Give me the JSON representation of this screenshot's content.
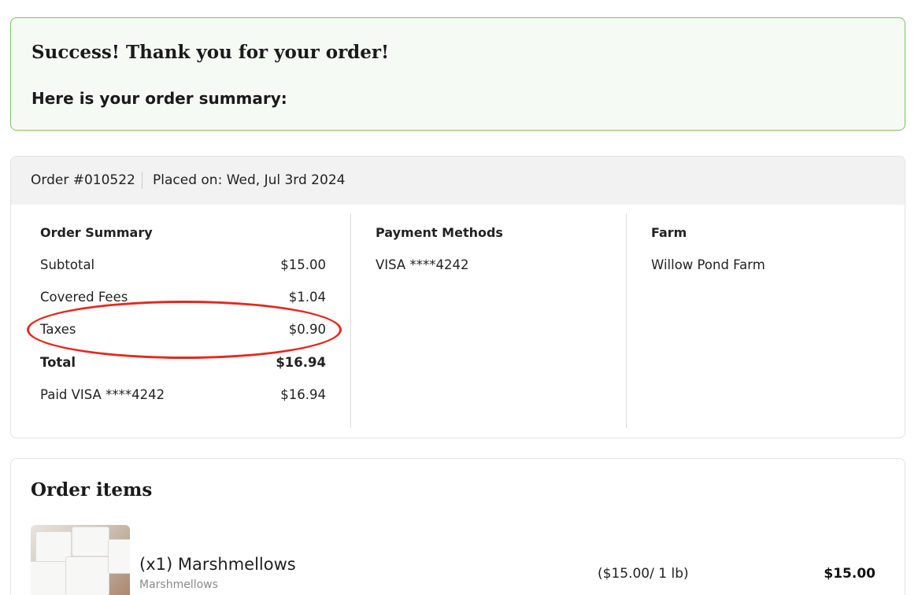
{
  "success": {
    "title": "Success! Thank you for your order!",
    "subtitle": "Here is your order summary:"
  },
  "order": {
    "number": "Order #010522",
    "placed_on": "Placed on: Wed, Jul 3rd 2024"
  },
  "summary": {
    "heading": "Order Summary",
    "rows": [
      {
        "label": "Subtotal",
        "value": "$15.00"
      },
      {
        "label": "Covered Fees",
        "value": "$1.04"
      },
      {
        "label": "Taxes",
        "value": "$0.90"
      },
      {
        "label": "Total",
        "value": "$16.94"
      },
      {
        "label": "Paid VISA ****4242",
        "value": "$16.94"
      }
    ]
  },
  "payment": {
    "heading": "Payment Methods",
    "method": "VISA ****4242"
  },
  "farm": {
    "heading": "Farm",
    "name": "Willow Pond Farm"
  },
  "items": {
    "title": "Order items",
    "list": [
      {
        "name": "(x1) Marshmellows",
        "subtitle": "Marshmellows",
        "unit_price": "($15.00/ 1 lb)",
        "price": "$15.00"
      }
    ]
  },
  "colors": {
    "success_border": "#7dc26a",
    "highlight": "#e8271c"
  }
}
